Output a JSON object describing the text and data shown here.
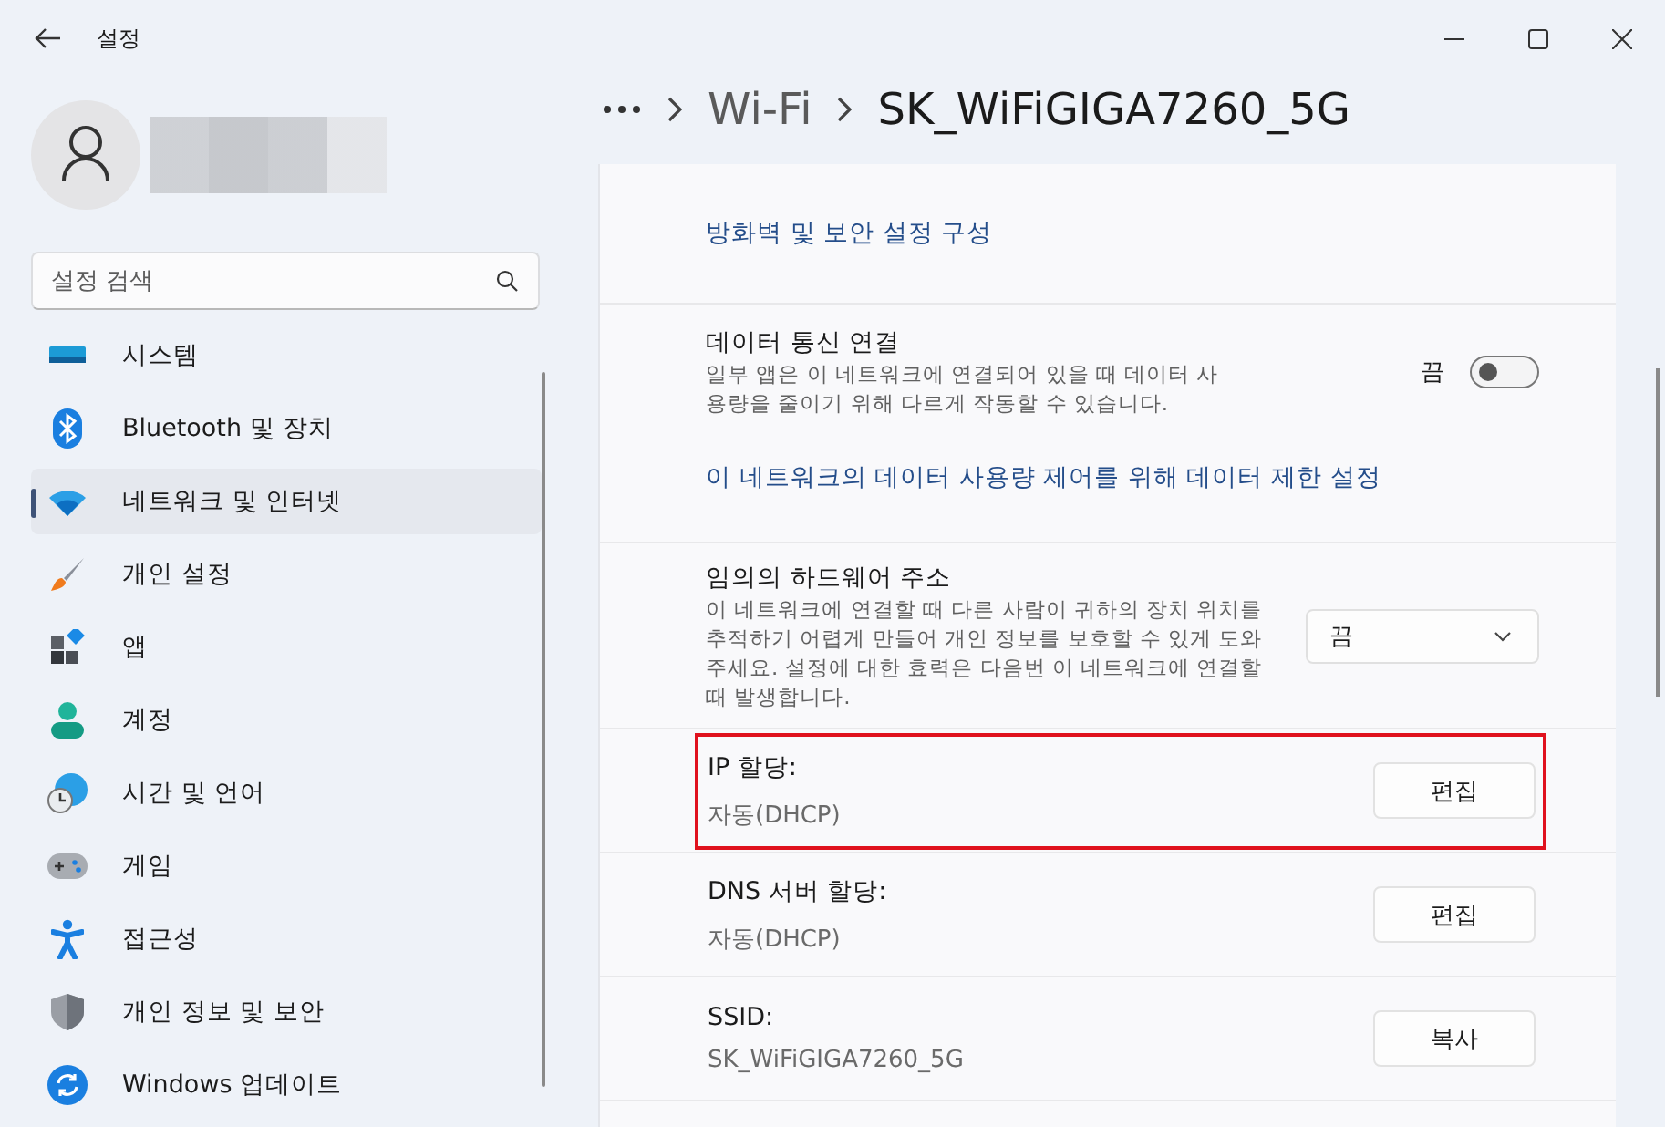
{
  "window": {
    "title": "설정"
  },
  "search": {
    "placeholder": "설정 검색"
  },
  "nav": [
    {
      "label": "시스템",
      "selected": false
    },
    {
      "label": "Bluetooth 및 장치",
      "selected": false
    },
    {
      "label": "네트워크 및 인터넷",
      "selected": true
    },
    {
      "label": "개인 설정",
      "selected": false
    },
    {
      "label": "앱",
      "selected": false
    },
    {
      "label": "계정",
      "selected": false
    },
    {
      "label": "시간 및 언어",
      "selected": false
    },
    {
      "label": "게임",
      "selected": false
    },
    {
      "label": "접근성",
      "selected": false
    },
    {
      "label": "개인 정보 및 보안",
      "selected": false
    },
    {
      "label": "Windows 업데이트",
      "selected": false
    }
  ],
  "breadcrumb": [
    "Wi-Fi",
    "SK_WiFiGIGA7260_5G"
  ],
  "sections": [
    {
      "kind": "link",
      "label": "방화벽 및 보안 설정 구성"
    },
    {
      "kind": "toggle",
      "title": "데이터 통신 연결",
      "description": "일부 앱은 이 네트워크에 연결되어 있을 때 데이터 사용량을 줄이기 위해 다르게 작동할 수 있습니다.",
      "state_label": "끔",
      "on": false,
      "link": "이 네트워크의 데이터 사용량 제어를 위해 데이터 제한 설정"
    },
    {
      "kind": "dropdown",
      "title": "임의의 하드웨어 주소",
      "description": "이 네트워크에 연결할 때 다른 사람이 귀하의 장치 위치를 추적하기 어렵게 만들어 개인 정보를 보호할 수 있게 도와주세요. 설정에 대한 효력은 다음번 이 네트워크에 연결할 때 발생합니다.",
      "value": "끔"
    },
    {
      "kind": "button",
      "title": "IP 할당:",
      "value": "자동(DHCP)",
      "button": "편집",
      "highlighted": true
    },
    {
      "kind": "button",
      "title": "DNS 서버 할당:",
      "value": "자동(DHCP)",
      "button": "편집",
      "highlighted": false
    },
    {
      "kind": "button",
      "title": "SSID:",
      "value": "SK_WiFiGIGA7260_5G",
      "button": "복사",
      "highlighted": false
    }
  ]
}
